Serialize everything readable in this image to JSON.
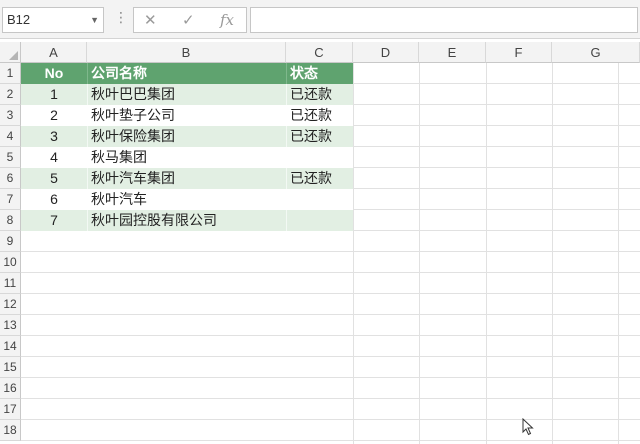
{
  "formula_bar": {
    "name_box": "B12",
    "fx_label": "fx",
    "formula_value": ""
  },
  "columns": [
    "A",
    "B",
    "C",
    "D",
    "E",
    "F",
    "G"
  ],
  "rows": [
    "1",
    "2",
    "3",
    "4",
    "5",
    "6",
    "7",
    "8",
    "9",
    "10",
    "11",
    "12",
    "13",
    "14",
    "15",
    "16",
    "17",
    "18"
  ],
  "table": {
    "headers": {
      "a": "No",
      "b": "公司名称",
      "c": "状态"
    },
    "records": [
      {
        "no": "1",
        "company": "秋叶巴巴集团",
        "status": "已还款"
      },
      {
        "no": "2",
        "company": "秋叶垫子公司",
        "status": "已还款"
      },
      {
        "no": "3",
        "company": "秋叶保险集团",
        "status": "已还款"
      },
      {
        "no": "4",
        "company": "秋马集团",
        "status": ""
      },
      {
        "no": "5",
        "company": "秋叶汽车集团",
        "status": "已还款"
      },
      {
        "no": "6",
        "company": "秋叶汽车",
        "status": ""
      },
      {
        "no": "7",
        "company": "秋叶园控股有限公司",
        "status": ""
      }
    ]
  },
  "colors": {
    "header_fill": "#5fa36f",
    "band_fill": "#e2efe3"
  }
}
